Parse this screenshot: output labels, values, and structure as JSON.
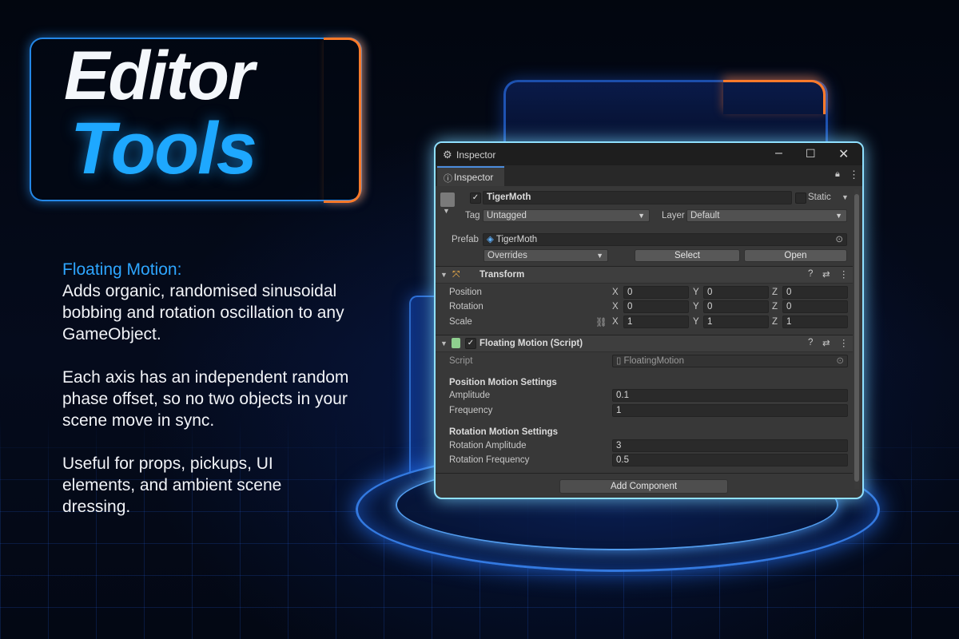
{
  "title": {
    "line1": "Editor",
    "line2": "Tools"
  },
  "description": {
    "heading": "Floating Motion:",
    "p1": "Adds organic, randomised sinusoidal bobbing and rotation oscillation to any GameObject.",
    "p2": "Each axis has an independent random phase offset, so no two objects in your scene move in sync.",
    "p3": "Useful for props, pickups, UI elements, and ambient scene dressing."
  },
  "window": {
    "title": "Inspector",
    "tab_label": "Inspector",
    "icons": {
      "minimize": "minimize-icon",
      "maximize": "maximize-icon",
      "close": "close-icon",
      "lock": "lock-icon",
      "menu": "kebab-menu-icon"
    }
  },
  "gameobject": {
    "active_check": "✓",
    "name": "TigerMoth",
    "static_label": "Static",
    "tag_label": "Tag",
    "tag_value": "Untagged",
    "layer_label": "Layer",
    "layer_value": "Default",
    "prefab_label": "Prefab",
    "prefab_value": "TigerMoth",
    "overrides_label": "Overrides",
    "select_label": "Select",
    "open_label": "Open"
  },
  "transform": {
    "header": "Transform",
    "rows": [
      {
        "label": "Position",
        "x": "0",
        "y": "0",
        "z": "0"
      },
      {
        "label": "Rotation",
        "x": "0",
        "y": "0",
        "z": "0"
      },
      {
        "label": "Scale",
        "x": "1",
        "y": "1",
        "z": "1"
      }
    ],
    "axis": {
      "x": "X",
      "y": "Y",
      "z": "Z"
    }
  },
  "floating_motion": {
    "header": "Floating Motion (Script)",
    "script_label": "Script",
    "script_value": "FloatingMotion",
    "pos_section": "Position Motion Settings",
    "amplitude_label": "Amplitude",
    "amplitude_value": "0.1",
    "frequency_label": "Frequency",
    "frequency_value": "1",
    "rot_section": "Rotation Motion Settings",
    "rot_amplitude_label": "Rotation Amplitude",
    "rot_amplitude_value": "3",
    "rot_frequency_label": "Rotation Frequency",
    "rot_frequency_value": "0.5"
  },
  "add_component_label": "Add Component",
  "colors": {
    "accent_blue": "#1ea8ff",
    "accent_orange": "#ff7a2a",
    "window_glow": "#8fe0ff",
    "panel_bg": "#383838"
  }
}
